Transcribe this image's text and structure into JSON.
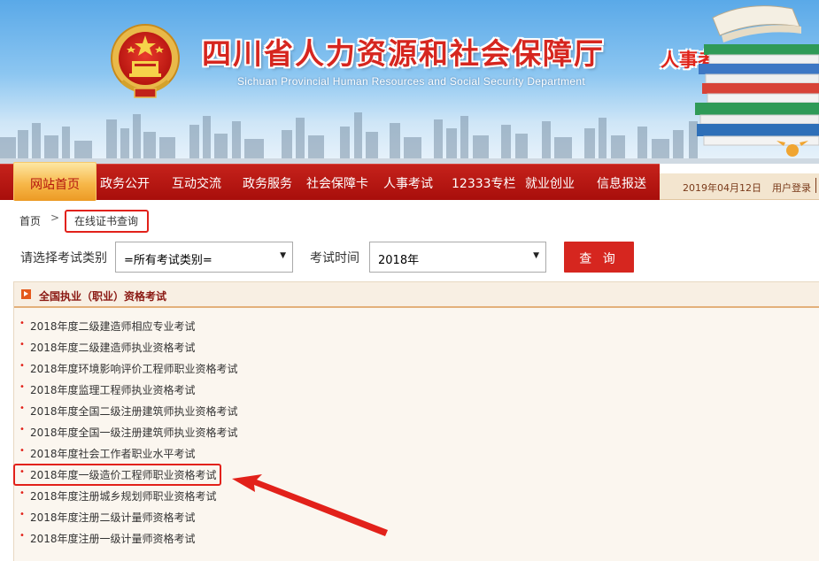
{
  "header": {
    "site_title": "四川省人力资源和社会保障厅",
    "site_subtitle": "Sichuan Provincial Human Resources and Social Security Department",
    "column_title": "人事考试专栏"
  },
  "nav": {
    "items": [
      {
        "label": "网站首页",
        "active": true
      },
      {
        "label": "政务公开"
      },
      {
        "label": "互动交流"
      },
      {
        "label": "政务服务"
      },
      {
        "label": "社会保障卡"
      },
      {
        "label": "人事考试"
      },
      {
        "label": "12333专栏"
      },
      {
        "label": "就业创业"
      },
      {
        "label": "信息报送"
      }
    ],
    "date": "2019年04月12日",
    "login": "用户登录"
  },
  "breadcrumb": {
    "home": "首页",
    "separator": ">",
    "current": "在线证书查询"
  },
  "filters": {
    "category_label": "请选择考试类别",
    "category_value": "=所有考试类别=",
    "time_label": "考试时间",
    "time_value": "2018年",
    "query_button": "查 询"
  },
  "panel": {
    "title": "全国执业（职业）资格考试",
    "exams": [
      "2018年度二级建造师相应专业考试",
      "2018年度二级建造师执业资格考试",
      "2018年度环境影响评价工程师职业资格考试",
      "2018年度监理工程师执业资格考试",
      "2018年度全国二级注册建筑师执业资格考试",
      "2018年度全国一级注册建筑师执业资格考试",
      "2018年度社会工作者职业水平考试",
      "2018年度一级造价工程师职业资格考试",
      "2018年度注册城乡规划师职业资格考试",
      "2018年度注册二级计量师资格考试",
      "2018年度注册一级计量师资格考试"
    ]
  },
  "colors": {
    "brand_red": "#d6261f",
    "nav_red": "#b4140e",
    "annotation_red": "#e2211a",
    "panel_bg": "#fbf6ef"
  }
}
